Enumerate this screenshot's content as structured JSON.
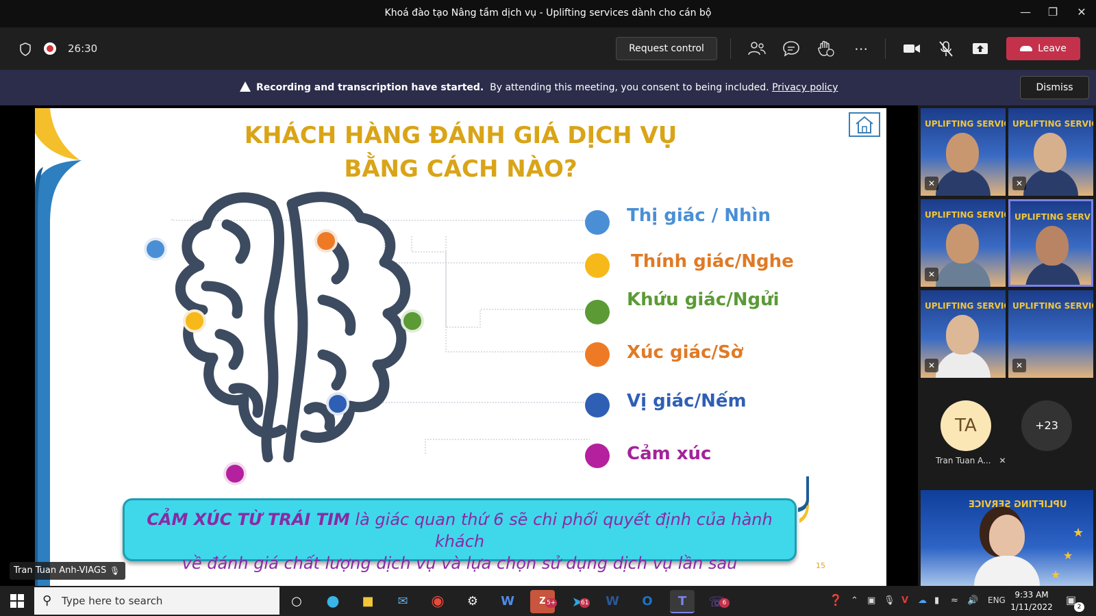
{
  "window": {
    "title": "Khoá đào tạo Nâng tầm dịch vụ - Uplifting services dành cho cán bộ"
  },
  "toolbar": {
    "timer": "26:30",
    "request_control": "Request control",
    "leave": "Leave"
  },
  "banner": {
    "bold": "Recording and transcription have started.",
    "text": "By attending this meeting, you consent to being included.",
    "link": "Privacy policy",
    "dismiss": "Dismiss"
  },
  "slide": {
    "title_line1": "KHÁCH HÀNG ĐÁNH GIÁ DỊCH VỤ",
    "title_line2": "BẰNG CÁCH NÀO?",
    "senses": [
      {
        "label": "Thị giác / Nhìn",
        "color": "#4a8fd6"
      },
      {
        "label": "Thính giác/Nghe",
        "color": "#e07a26"
      },
      {
        "label": "Khứu giác/Ngửi",
        "color": "#5b9a35"
      },
      {
        "label": "Xúc giác/Sờ",
        "color": "#e07a26"
      },
      {
        "label": "Vị giác/Nếm",
        "color": "#2f5fb5"
      },
      {
        "label": "Cảm xúc",
        "color": "#a4239a"
      }
    ],
    "callout_bold": "CẢM XÚC TỪ TRÁI TIM",
    "callout_rest": " là giác quan thứ 6 sẽ chi phối quyết định của hành khách",
    "callout_line2": "về đánh giá chất lượng dịch vụ và lựa chọn sử dụng dịch vụ lần sau",
    "page_number": "15",
    "presenter": "Tran Tuan Anh-VIAGS"
  },
  "participants": {
    "tile_brand": "UPLIFTING SERVICE",
    "avatar_initials": "TA",
    "avatar_name": "Tran Tuan A...",
    "overflow": "+23",
    "self_brand": "UPLIFTING SERVICE"
  },
  "taskbar": {
    "search_placeholder": "Type here to search",
    "language": "ENG",
    "time": "9:33 AM",
    "date": "1/11/2022",
    "zalo_badge": "5+",
    "telegram_badge": "61",
    "viber_badge": "6",
    "notifications_badge": "2"
  }
}
